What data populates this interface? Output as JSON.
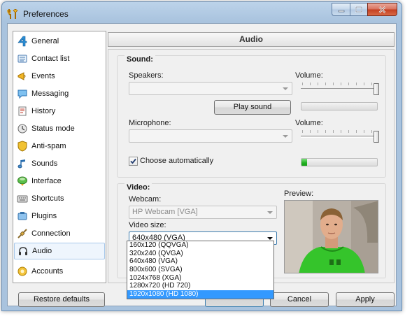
{
  "window": {
    "title": "Preferences"
  },
  "sidebar": {
    "items": [
      {
        "label": "General",
        "icon": "general-icon",
        "selected": false
      },
      {
        "label": "Contact list",
        "icon": "contact-list-icon",
        "selected": false
      },
      {
        "label": "Events",
        "icon": "events-icon",
        "selected": false
      },
      {
        "label": "Messaging",
        "icon": "messaging-icon",
        "selected": false
      },
      {
        "label": "History",
        "icon": "history-icon",
        "selected": false
      },
      {
        "label": "Status mode",
        "icon": "status-mode-icon",
        "selected": false
      },
      {
        "label": "Anti-spam",
        "icon": "anti-spam-icon",
        "selected": false
      },
      {
        "label": "Sounds",
        "icon": "sounds-icon",
        "selected": false
      },
      {
        "label": "Interface",
        "icon": "interface-icon",
        "selected": false
      },
      {
        "label": "Shortcuts",
        "icon": "shortcuts-icon",
        "selected": false
      },
      {
        "label": "Plugins",
        "icon": "plugins-icon",
        "selected": false
      },
      {
        "label": "Connection",
        "icon": "connection-icon",
        "selected": false
      },
      {
        "label": "Audio",
        "icon": "headset-icon",
        "selected": true
      },
      {
        "label": "Accounts",
        "icon": "accounts-icon",
        "selected": false
      }
    ]
  },
  "header": {
    "title": "Audio"
  },
  "sound": {
    "title": "Sound:",
    "speakers_label": "Speakers:",
    "speakers_value": "",
    "volume_label": "Volume:",
    "speaker_volume": 1.0,
    "play_label": "Play sound",
    "speaker_level": 0.0,
    "microphone_label": "Microphone:",
    "microphone_value": "",
    "mic_volume_label": "Volume:",
    "mic_volume": 1.0,
    "mic_level": 0.07,
    "choose_auto_label": "Choose automatically",
    "choose_auto_checked": true
  },
  "video": {
    "title": "Video:",
    "webcam_label": "Webcam:",
    "webcam_value": "HP Webcam [VGA]",
    "size_label": "Video size:",
    "size_value": "640x480 (VGA)",
    "preview_label": "Preview:",
    "size_options": [
      "160x120 (QQVGA)",
      "320x240 (QVGA)",
      "640x480 (VGA)",
      "800x600 (SVGA)",
      "1024x768 (XGA)",
      "1280x720 (HD 720)",
      "1920x1080 (HD 1080)"
    ],
    "highlighted_option": "1920x1080 (HD 1080)"
  },
  "buttons": {
    "restore": "Restore defaults",
    "cancel": "Cancel",
    "apply": "Apply"
  }
}
